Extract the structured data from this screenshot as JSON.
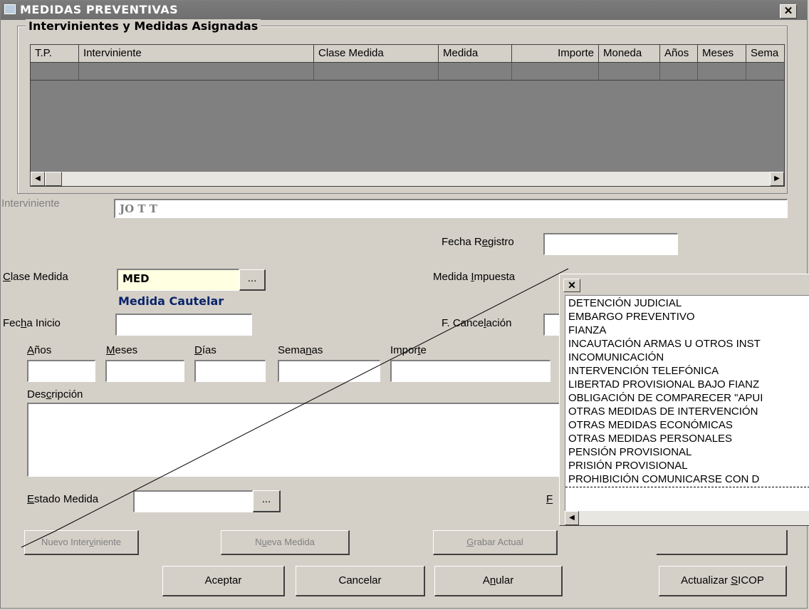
{
  "window": {
    "title": "MEDIDAS PREVENTIVAS",
    "close_glyph": "✕"
  },
  "group": {
    "title": "Intervinientes y Medidas Asignadas"
  },
  "grid": {
    "columns": [
      "T.P.",
      "Interviniente",
      "Clase Medida",
      "Medida",
      "Importe",
      "Moneda",
      "Años",
      "Meses",
      "Sema"
    ]
  },
  "form": {
    "interviniente_label": "Interviniente",
    "interviniente_value": "JO T T",
    "fecha_registro_label": "Fecha Registro",
    "clase_medida_label": "Clase Medida",
    "clase_medida_value": "MED",
    "clase_medida_desc": "Medida Cautelar",
    "medida_impuesta_label": "Medida Impuesta",
    "fecha_inicio_label": "Fecha Inicio",
    "f_cancelacion_label": "F. Cancelación",
    "anios_label": "Años",
    "meses_label": "Meses",
    "dias_label": "Días",
    "semanas_label": "Semanas",
    "importe_label": "Importe",
    "descripcion_label": "Descripción",
    "estado_medida_label": "Estado Medida",
    "f_label_partial": "F",
    "ellipsis": "..."
  },
  "buttons": {
    "nuevo_interviniente": "Nuevo Interviniente",
    "nueva_medida": "Nueva Medida",
    "grabar_actual": "Grabar Actual",
    "aceptar": "Aceptar",
    "cancelar": "Cancelar",
    "anular": "Anular",
    "actualizar_sicop": "Actualizar SICOP"
  },
  "dropdown": {
    "close_glyph": "✕",
    "items": [
      "DETENCIÓN JUDICIAL",
      "EMBARGO PREVENTIVO",
      "FIANZA",
      "INCAUTACIÓN ARMAS U OTROS INST",
      "INCOMUNICACIÓN",
      "INTERVENCIÓN TELEFÓNICA",
      "LIBERTAD PROVISIONAL BAJO FIANZ",
      "OBLIGACIÓN DE COMPARECER \"APUI",
      "OTRAS MEDIDAS DE INTERVENCIÓN",
      "OTRAS MEDIDAS ECONÓMICAS",
      "OTRAS MEDIDAS PERSONALES",
      "PENSIÓN PROVISIONAL",
      "PRISIÓN PROVISIONAL",
      "PROHIBICIÓN COMUNICARSE CON D"
    ]
  }
}
